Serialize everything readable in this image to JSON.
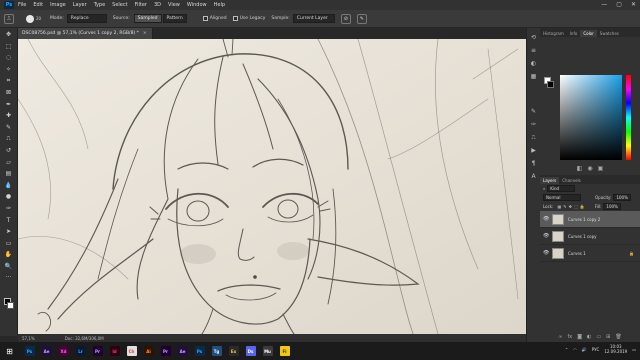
{
  "app": {
    "logo": "Ps",
    "name": "Photoshop"
  },
  "menu": [
    "File",
    "Edit",
    "Image",
    "Layer",
    "Type",
    "Select",
    "Filter",
    "3D",
    "View",
    "Window",
    "Help"
  ],
  "window_controls": [
    "—",
    "▢",
    "✕"
  ],
  "options": {
    "brush_size": "20",
    "mode_label": "Mode:",
    "mode_value": "Replace",
    "source_label": "Source:",
    "sampled_label": "Sampled",
    "pattern_label": "Pattern",
    "aligned_label": "Aligned",
    "use_legacy_label": "Use Legacy",
    "sample_label": "Sample:",
    "sample_value": "Current Layer"
  },
  "document": {
    "tab_title": "DSC08756.psd @ 57,1% (Curves 1 copy 2, RGB/8) *",
    "close_glyph": "×"
  },
  "status": {
    "zoom": "57,1%",
    "doc_size": "Doc: 32,6M/306,0M"
  },
  "panels": {
    "top_tabs": [
      "Histogram",
      "Info",
      "Color",
      "Swatches"
    ],
    "active_top_tab": "Color",
    "layers_tabs": [
      "Layers",
      "Channels"
    ],
    "active_layers_tab": "Layers",
    "kind_label": "Kind",
    "blend_mode": "Normal",
    "opacity_label": "Opacity:",
    "opacity_value": "100%",
    "lock_label": "Lock:",
    "fill_label": "Fill:",
    "fill_value": "100%",
    "layers": [
      {
        "name": "Curves 1 copy 2",
        "selected": true
      },
      {
        "name": "Curves 1 copy",
        "selected": false
      },
      {
        "name": "Curves 1",
        "selected": false
      }
    ],
    "color_accent": "#1aa0e8"
  },
  "taskbar": {
    "apps": [
      {
        "label": "Ps",
        "bg": "#0a2a4a",
        "fg": "#31a8ff"
      },
      {
        "label": "Ae",
        "bg": "#1f0f3a",
        "fg": "#c8a2ff"
      },
      {
        "label": "Xd",
        "bg": "#470137",
        "fg": "#ff61f6"
      },
      {
        "label": "Lr",
        "bg": "#0a1a33",
        "fg": "#3ea8ff"
      },
      {
        "label": "Pr",
        "bg": "#1e0033",
        "fg": "#c9a0ff"
      },
      {
        "label": "Id",
        "bg": "#2e0014",
        "fg": "#ff3366"
      },
      {
        "label": "Ch",
        "bg": "#e0e0e0",
        "fg": "#e53935"
      },
      {
        "label": "Ai",
        "bg": "#2b1300",
        "fg": "#ff9a00"
      },
      {
        "label": "Pr",
        "bg": "#1e0033",
        "fg": "#c9a0ff"
      },
      {
        "label": "Ae",
        "bg": "#1f0f3a",
        "fg": "#c8a2ff"
      },
      {
        "label": "Ps",
        "bg": "#0a2a4a",
        "fg": "#31a8ff"
      },
      {
        "label": "Tg",
        "bg": "#1d4f80",
        "fg": "#ffffff"
      },
      {
        "label": "Ex",
        "bg": "#2a2a2a",
        "fg": "#ffcc33"
      },
      {
        "label": "Ds",
        "bg": "#5865f2",
        "fg": "#ffffff"
      },
      {
        "label": "Mu",
        "bg": "#3a3a3a",
        "fg": "#ffffff"
      },
      {
        "label": "Fi",
        "bg": "#f2c811",
        "fg": "#333333"
      }
    ],
    "language": "РУС",
    "time": "10:03",
    "date": "12.09.2019"
  }
}
